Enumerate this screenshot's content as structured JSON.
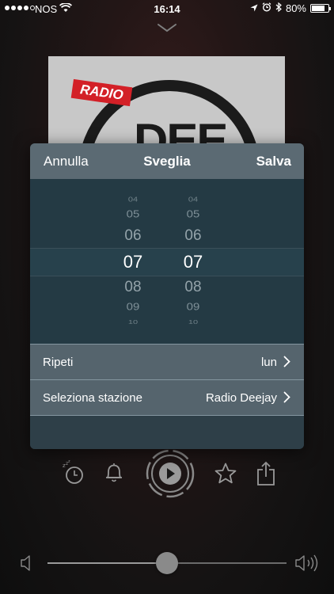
{
  "status_bar": {
    "carrier": "NOS",
    "time": "16:14",
    "battery": "80%",
    "battery_level": 0.8,
    "signal_bars_filled": 4
  },
  "modal": {
    "cancel_label": "Annulla",
    "title": "Sveglia",
    "save_label": "Salva",
    "hours": [
      "04",
      "05",
      "06",
      "07",
      "08",
      "09",
      "10"
    ],
    "minutes": [
      "04",
      "05",
      "06",
      "07",
      "08",
      "09",
      "10"
    ],
    "repeat": {
      "label": "Ripeti",
      "value": "lun"
    },
    "station": {
      "label": "Seleziona stazione",
      "value": "Radio Deejay"
    }
  },
  "album_art": {
    "badge_text": "RADIO",
    "logo_text": "DEE"
  },
  "volume": {
    "level": 0.5
  },
  "icons": [
    "chevron-down-icon",
    "wifi-icon",
    "location-icon",
    "alarm-clock-icon",
    "bluetooth-icon",
    "battery-icon",
    "sleep-timer-icon",
    "bell-icon",
    "play-icon",
    "star-icon",
    "share-icon",
    "speaker-low-icon",
    "speaker-high-icon",
    "chevron-right-icon"
  ],
  "colors": {
    "modal_header": "#5b6a73",
    "picker_bg": "#243a44",
    "row_bg": "#55646d",
    "logo_red": "#d32027"
  }
}
